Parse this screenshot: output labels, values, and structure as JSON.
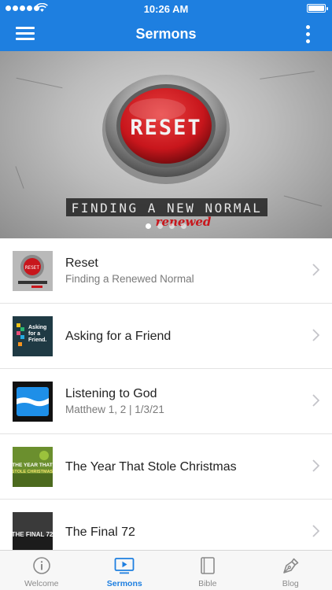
{
  "status_bar": {
    "time": "10:26 AM"
  },
  "nav": {
    "title": "Sermons",
    "menu_icon": "hamburger-menu-icon",
    "more_icon": "more-vertical-icon"
  },
  "hero": {
    "title": "RESET",
    "subtitle": "FINDING A NEW NORMAL",
    "overlay_word": "renewed",
    "slide_count": 4,
    "active_slide": 1
  },
  "sermons": [
    {
      "title": "Reset",
      "subtitle": "Finding a Renewed Normal",
      "thumb": "reset-thumbnail"
    },
    {
      "title": "Asking for a Friend",
      "subtitle": "",
      "thumb": "asking-for-a-friend-thumbnail",
      "thumb_text": "Asking for a Friend."
    },
    {
      "title": "Listening to God",
      "subtitle": "Matthew 1, 2 | 1/3/21",
      "thumb": "listening-to-god-thumbnail"
    },
    {
      "title": "The Year That Stole Christmas",
      "subtitle": "",
      "thumb": "year-stole-christmas-thumbnail",
      "thumb_text_1": "THE YEAR THAT",
      "thumb_text_2": "STOLE CHRISTMAS"
    },
    {
      "title": "The Final 72",
      "subtitle": "",
      "thumb": "final-72-thumbnail",
      "thumb_text": "THE FINAL 72"
    }
  ],
  "tabs": [
    {
      "label": "Welcome",
      "icon": "info-icon",
      "active": false
    },
    {
      "label": "Sermons",
      "icon": "video-play-icon",
      "active": true
    },
    {
      "label": "Bible",
      "icon": "book-icon",
      "active": false
    },
    {
      "label": "Blog",
      "icon": "pen-nib-icon",
      "active": false
    }
  ],
  "colors": {
    "primary": "#1e7fe0",
    "reset_red": "#c8161c"
  }
}
